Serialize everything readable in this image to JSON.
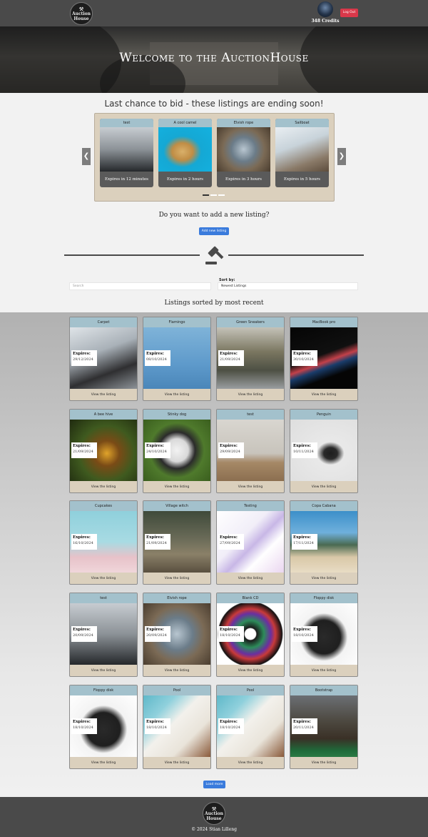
{
  "header": {
    "logo_text": [
      "Auction",
      "House"
    ],
    "credits": "348 Credits",
    "logout_label": "Log Out"
  },
  "hero": {
    "title": "Welcome to the AuctionHouse"
  },
  "ending_soon": {
    "title": "Last chance to bid - these listings are ending soon!",
    "prev_icon": "chevron-left-icon",
    "next_icon": "chevron-right-icon",
    "items": [
      {
        "title": "test",
        "expires": "Expires in 12 minutes",
        "image": "foggy-car"
      },
      {
        "title": "A cool camel",
        "expires": "Expires in 2 hours",
        "image": "camel"
      },
      {
        "title": "Elvish rope",
        "expires": "Expires in 3 hours",
        "image": "rope"
      },
      {
        "title": "Sailboat",
        "expires": "Expires in 5 hours",
        "image": "sailboat"
      }
    ]
  },
  "add_listing": {
    "question": "Do you want to add a new listing?",
    "button_label": "Add new listing"
  },
  "filters": {
    "search_placeholder": "Search",
    "sort_label": "Sort by:",
    "sort_value": "Newest Listings"
  },
  "listings": {
    "title": "Listings sorted by most recent",
    "expires_label": "Expires:",
    "view_label": "View the listing",
    "items": [
      {
        "title": "Carpet",
        "expires": "29/12/2024",
        "image": "typewriter"
      },
      {
        "title": "Flamingo",
        "expires": "08/10/2024",
        "image": "flamingo"
      },
      {
        "title": "Green Sneakers",
        "expires": "21/09/2024",
        "image": "sneakers"
      },
      {
        "title": "MacBook pro",
        "expires": "30/10/2024",
        "image": "macbook"
      },
      {
        "title": "A bee hive",
        "expires": "21/09/2024",
        "image": "wasp"
      },
      {
        "title": "Stinky dog",
        "expires": "24/10/2024",
        "image": "dog"
      },
      {
        "title": "test",
        "expires": "29/09/2024",
        "image": "chair"
      },
      {
        "title": "Penguin",
        "expires": "10/11/2024",
        "image": "penguin"
      },
      {
        "title": "Cupcakes",
        "expires": "16/10/2024",
        "image": "cupcakes"
      },
      {
        "title": "Village witch",
        "expires": "21/09/2024",
        "image": "witch"
      },
      {
        "title": "Testing",
        "expires": "27/09/2024",
        "image": "illustration"
      },
      {
        "title": "Copa Cabana",
        "expires": "17/11/2024",
        "image": "beach"
      },
      {
        "title": "test",
        "expires": "20/09/2024",
        "image": "foggy-car"
      },
      {
        "title": "Elvish rope",
        "expires": "20/09/2024",
        "image": "rope"
      },
      {
        "title": "Blank CD",
        "expires": "18/10/2024",
        "image": "cd"
      },
      {
        "title": "Floppy disk",
        "expires": "18/10/2024",
        "image": "floppy"
      },
      {
        "title": "Floppy disk",
        "expires": "18/10/2024",
        "image": "floppy"
      },
      {
        "title": "Pool",
        "expires": "18/10/2024",
        "image": "pool"
      },
      {
        "title": "Pool",
        "expires": "18/10/2024",
        "image": "pool"
      },
      {
        "title": "Bootstrap",
        "expires": "20/11/2024",
        "image": "figure"
      }
    ],
    "load_more_label": "Load more"
  },
  "footer": {
    "copyright": "© 2024 Stian Lilleng"
  },
  "colors": {
    "header_bg": "#4a4a4a",
    "card_title_bg": "#a3c1cc",
    "card_bg": "#dbd0bd",
    "primary_button": "#3a7bdc",
    "logout_button": "#d9384a"
  }
}
